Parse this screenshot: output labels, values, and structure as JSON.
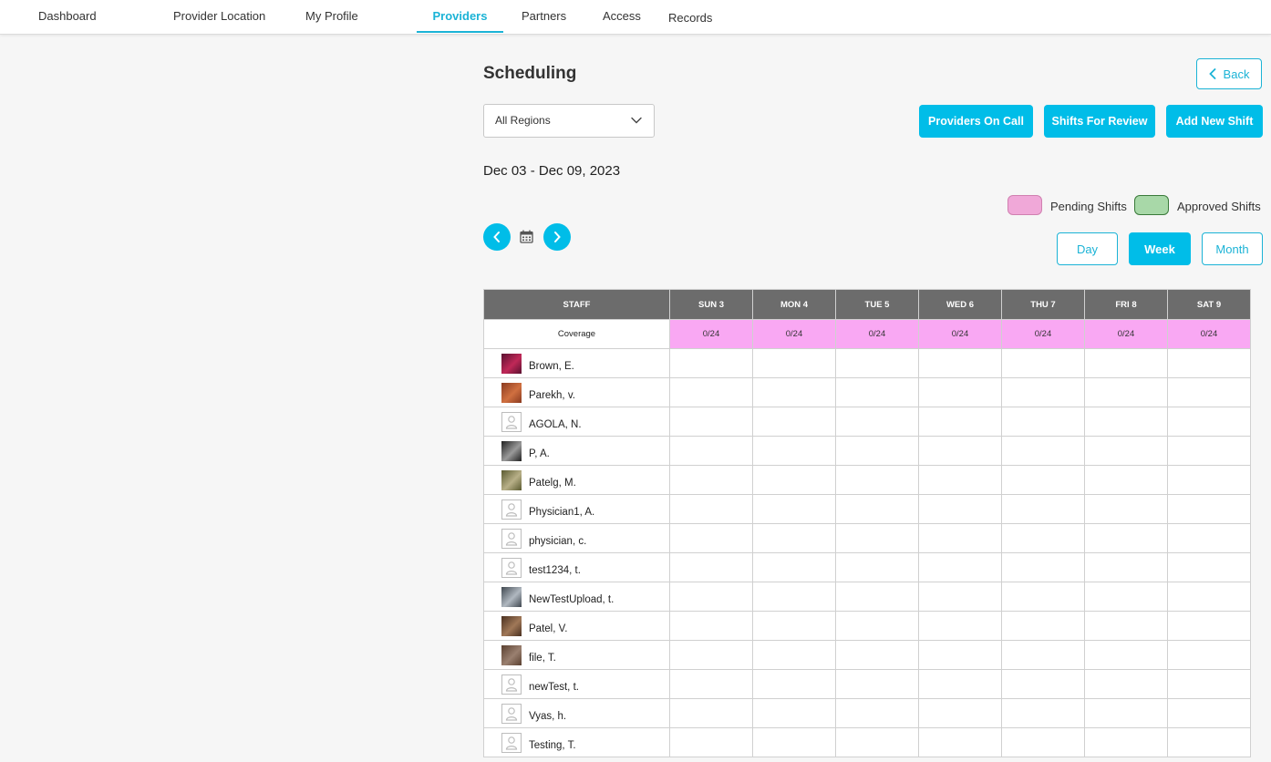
{
  "nav": {
    "items": [
      {
        "label": "Dashboard"
      },
      {
        "label": "Provider Location"
      },
      {
        "label": "My Profile"
      },
      {
        "label": "Providers"
      },
      {
        "label": "Partners"
      },
      {
        "label": "Access"
      },
      {
        "label": "Records"
      }
    ],
    "active": "Providers"
  },
  "page": {
    "title": "Scheduling",
    "back_label": "Back",
    "region_value": "All Regions",
    "date_range": "Dec 03 - Dec 09, 2023"
  },
  "actions": {
    "providers_on_call": "Providers On Call",
    "shifts_for_review": "Shifts For Review",
    "add_new_shift": "Add New Shift"
  },
  "legend": {
    "pending_label": "Pending Shifts",
    "pending_color": "#f0a8d8",
    "approved_label": "Approved Shifts",
    "approved_color": "#a8d8a8"
  },
  "views": {
    "day": "Day",
    "week": "Week",
    "month": "Month",
    "selected": "Week"
  },
  "table": {
    "staff_header": "STAFF",
    "days": [
      "SUN 3",
      "MON 4",
      "TUE 5",
      "WED 6",
      "THU 7",
      "FRI 8",
      "SAT 9"
    ],
    "coverage_label": "Coverage",
    "coverage": [
      "0/24",
      "0/24",
      "0/24",
      "0/24",
      "0/24",
      "0/24",
      "0/24"
    ],
    "staff": [
      {
        "name": "Brown, E.",
        "avatar": "photo",
        "colors": [
          "#5a1030",
          "#c02858"
        ]
      },
      {
        "name": "Parekh, v.",
        "avatar": "photo",
        "colors": [
          "#8a3a20",
          "#d07040"
        ]
      },
      {
        "name": "AGOLA, N.",
        "avatar": "placeholder"
      },
      {
        "name": "P, A.",
        "avatar": "photo",
        "colors": [
          "#202020",
          "#9a9a9a"
        ]
      },
      {
        "name": "Patelg, M.",
        "avatar": "photo",
        "colors": [
          "#5a5a30",
          "#b8b088"
        ]
      },
      {
        "name": "Physician1, A.",
        "avatar": "placeholder"
      },
      {
        "name": "physician, c.",
        "avatar": "placeholder"
      },
      {
        "name": "test1234, t.",
        "avatar": "placeholder"
      },
      {
        "name": "NewTestUpload, t.",
        "avatar": "photo",
        "colors": [
          "#404850",
          "#b0b8c0"
        ]
      },
      {
        "name": "Patel, V.",
        "avatar": "photo",
        "colors": [
          "#4a3020",
          "#a07858"
        ]
      },
      {
        "name": "file, T.",
        "avatar": "photo",
        "colors": [
          "#5a4030",
          "#9a8070"
        ]
      },
      {
        "name": "newTest, t.",
        "avatar": "placeholder"
      },
      {
        "name": "Vyas, h.",
        "avatar": "placeholder"
      },
      {
        "name": "Testing, T.",
        "avatar": "placeholder"
      }
    ]
  }
}
